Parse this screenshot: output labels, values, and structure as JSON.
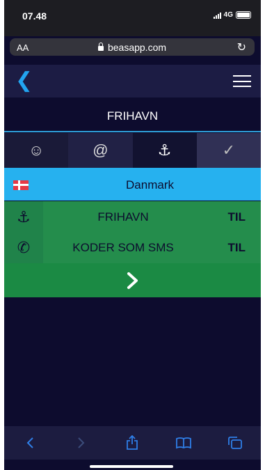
{
  "status_bar": {
    "time": "07.48",
    "network": "4G"
  },
  "browser": {
    "text_size_label": "AA",
    "url": "beasapp.com"
  },
  "page": {
    "title": "FRIHAVN"
  },
  "tabs": [
    {
      "icon": "smiley-icon",
      "symbol": "☺"
    },
    {
      "icon": "at-icon",
      "symbol": "@"
    },
    {
      "icon": "anchor-icon",
      "symbol": "⚓"
    },
    {
      "icon": "checkmark-icon",
      "symbol": "✓"
    }
  ],
  "country": {
    "name": "Danmark",
    "flag": "danish-flag-icon"
  },
  "rows": [
    {
      "icon": "anchor-icon",
      "symbol": "⚓",
      "label": "FRIHAVN",
      "status": "TIL"
    },
    {
      "icon": "phone-icon",
      "symbol": "✆",
      "label": "KODER SOM SMS",
      "status": "TIL"
    }
  ],
  "colors": {
    "background": "#0d0c2e",
    "accent_blue": "#26b1ef",
    "green": "#248d4c",
    "toolbar_blue": "#2f7fe8"
  }
}
